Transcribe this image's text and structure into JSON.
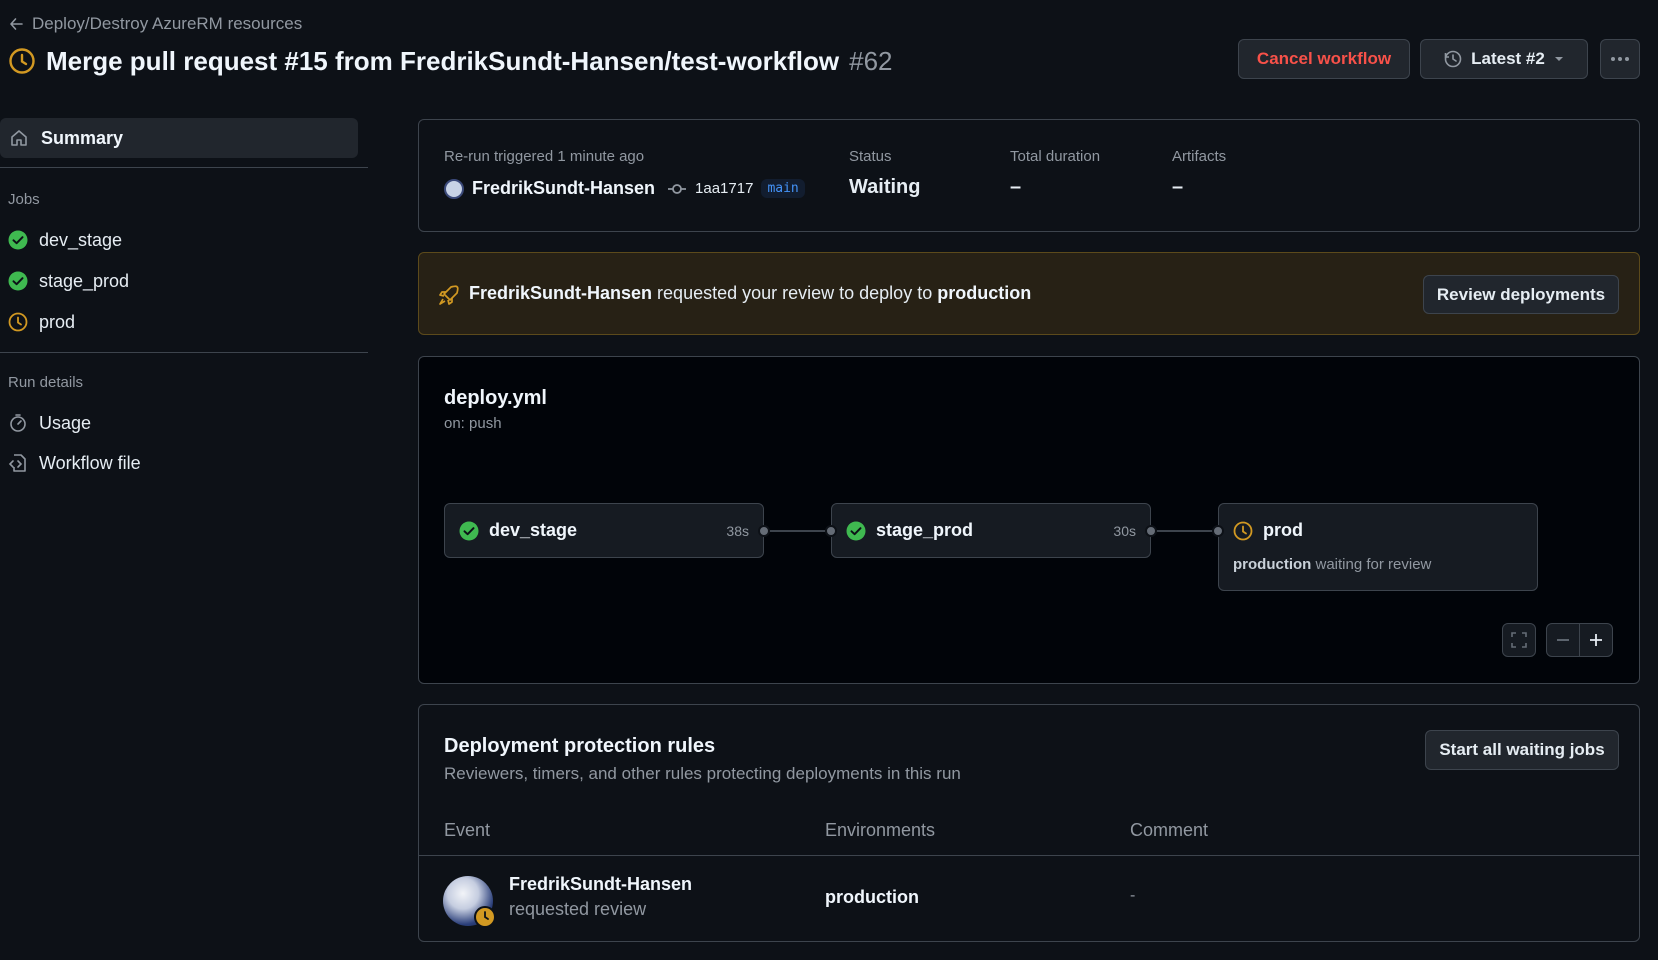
{
  "breadcrumb": {
    "label": "Deploy/Destroy AzureRM resources"
  },
  "header": {
    "title": "Merge pull request #15 from FredrikSundt-Hansen/test-workflow",
    "run_number": "#62",
    "cancel_label": "Cancel workflow",
    "attempt_label": "Latest #2"
  },
  "sidebar": {
    "summary_label": "Summary",
    "jobs_heading": "Jobs",
    "jobs": [
      {
        "label": "dev_stage",
        "status": "success"
      },
      {
        "label": "stage_prod",
        "status": "success"
      },
      {
        "label": "prod",
        "status": "waiting"
      }
    ],
    "run_details_heading": "Run details",
    "usage_label": "Usage",
    "workflow_file_label": "Workflow file"
  },
  "summary": {
    "trigger_label": "Re-run triggered",
    "trigger_time": "1 minute ago",
    "actor": "FredrikSundt-Hansen",
    "commit": "1aa1717",
    "branch": "main",
    "status_label": "Status",
    "status_value": "Waiting",
    "duration_label": "Total duration",
    "duration_value": "–",
    "artifacts_label": "Artifacts",
    "artifacts_value": "–"
  },
  "review_banner": {
    "actor": "FredrikSundt-Hansen",
    "text": "requested your review to deploy to",
    "environment": "production",
    "button_label": "Review deployments"
  },
  "graph": {
    "file_name": "deploy.yml",
    "trigger": "on: push",
    "jobs": [
      {
        "name": "dev_stage",
        "duration": "38s",
        "status": "success"
      },
      {
        "name": "stage_prod",
        "duration": "30s",
        "status": "success"
      },
      {
        "name": "prod",
        "status": "waiting",
        "environment": "production",
        "note": "waiting for review"
      }
    ]
  },
  "protection": {
    "title": "Deployment protection rules",
    "subtitle": "Reviewers, timers, and other rules protecting deployments in this run",
    "button_label": "Start all waiting jobs",
    "columns": [
      "Event",
      "Environments",
      "Comment"
    ],
    "rows": [
      {
        "actor": "FredrikSundt-Hansen",
        "event": "requested review",
        "environment": "production",
        "comment": "-"
      }
    ]
  },
  "colors": {
    "background": "#0d1117",
    "success": "#3fb950",
    "waiting": "#d29922",
    "danger": "#f85149",
    "accent": "#4493f8"
  }
}
